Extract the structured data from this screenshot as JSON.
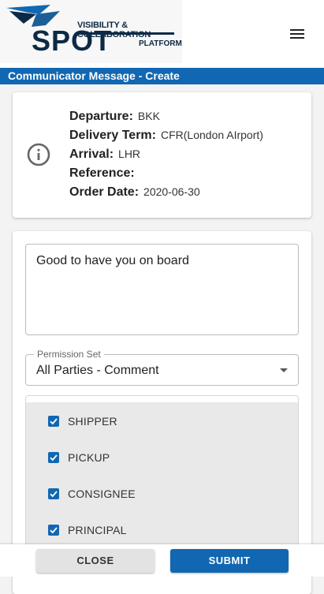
{
  "app": {
    "logo_text": "SPOT",
    "logo_tagline_1": "VISIBILITY & COLLABORATION",
    "logo_tagline_2": "PLATFORM",
    "menu_icon": "hamburger-menu-icon"
  },
  "page": {
    "title": "Communicator Message - Create"
  },
  "info": {
    "icon": "info-circle-icon",
    "rows": [
      {
        "label": "Departure:",
        "value": "BKK"
      },
      {
        "label": "Delivery Term:",
        "value": "CFR(London AIrport)"
      },
      {
        "label": "Arrival:",
        "value": "LHR"
      },
      {
        "label": "Reference:",
        "value": ""
      },
      {
        "label": "Order Date:",
        "value": "2020-06-30"
      }
    ]
  },
  "form": {
    "message": "Good to have you on board",
    "permission_label": "Permission Set",
    "permission_value": "All Parties - Comment",
    "parties": [
      {
        "label": "SHIPPER",
        "checked": true
      },
      {
        "label": "PICKUP",
        "checked": true
      },
      {
        "label": "CONSIGNEE",
        "checked": true
      },
      {
        "label": "PRINCIPAL",
        "checked": true
      }
    ]
  },
  "footer": {
    "close_label": "CLOSE",
    "submit_label": "SUBMIT"
  },
  "colors": {
    "accent": "#1167b1",
    "logo_navy": "#0d2a45"
  }
}
